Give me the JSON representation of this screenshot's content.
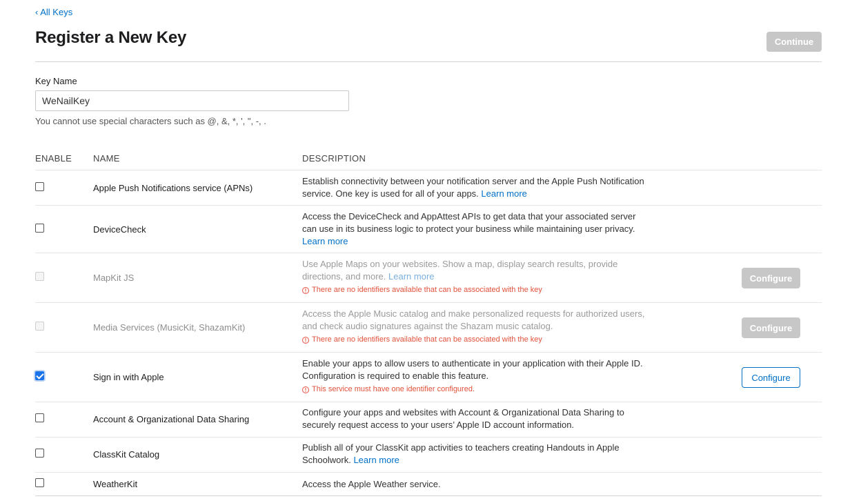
{
  "back_link": "All Keys",
  "back_chevron": "‹",
  "title": "Register a New Key",
  "continue_label": "Continue",
  "key_name": {
    "label": "Key Name",
    "value": "WeNailKey",
    "hint": "You cannot use special characters such as @, &, *, ', \", -, ."
  },
  "columns": {
    "enable": "ENABLE",
    "name": "NAME",
    "description": "DESCRIPTION"
  },
  "services": [
    {
      "name": "Apple Push Notifications service (APNs)",
      "desc": "Establish connectivity between your notification server and the Apple Push Notification service. One key is used for all of your apps.",
      "learn": "Learn more",
      "checked": false,
      "disabled": false
    },
    {
      "name": "DeviceCheck",
      "desc": "Access the DeviceCheck and AppAttest APIs to get data that your associated server can use in its business logic to protect your business while maintaining user privacy.",
      "learn": "Learn more",
      "checked": false,
      "disabled": false
    },
    {
      "name": "MapKit JS",
      "desc": "Use Apple Maps on your websites. Show a map, display search results, provide directions, and more.",
      "learn": "Learn more",
      "warning": "There are no identifiers available that can be associated with the key",
      "configure": "Configure",
      "checked": false,
      "disabled": true
    },
    {
      "name": "Media Services (MusicKit, ShazamKit)",
      "desc": "Access the Apple Music catalog and make personalized requests for authorized users, and check audio signatures against the Shazam music catalog.",
      "warning": "There are no identifiers available that can be associated with the key",
      "configure": "Configure",
      "checked": false,
      "disabled": true
    },
    {
      "name": "Sign in with Apple",
      "desc": "Enable your apps to allow users to authenticate in your application with their Apple ID. Configuration is required to enable this feature.",
      "warning": "This service must have one identifier configured.",
      "configure": "Configure",
      "checked": true,
      "disabled": false
    },
    {
      "name": "Account & Organizational Data Sharing",
      "desc": "Configure your apps and websites with Account & Organizational Data Sharing to securely request access to your users’ Apple ID account information.",
      "checked": false,
      "disabled": false
    },
    {
      "name": "ClassKit Catalog",
      "desc": "Publish all of your ClassKit app activities to teachers creating Handouts in Apple Schoolwork.",
      "learn": "Learn more",
      "checked": false,
      "disabled": false
    },
    {
      "name": "WeatherKit",
      "desc": "Access the Apple Weather service.",
      "checked": false,
      "disabled": false
    }
  ],
  "warning_glyph": "!",
  "colors": {
    "accent": "#0070c9",
    "warning": "#e2503b",
    "disabled_button": "#c7c7c7",
    "checkbox_checked": "#1a73e8"
  }
}
